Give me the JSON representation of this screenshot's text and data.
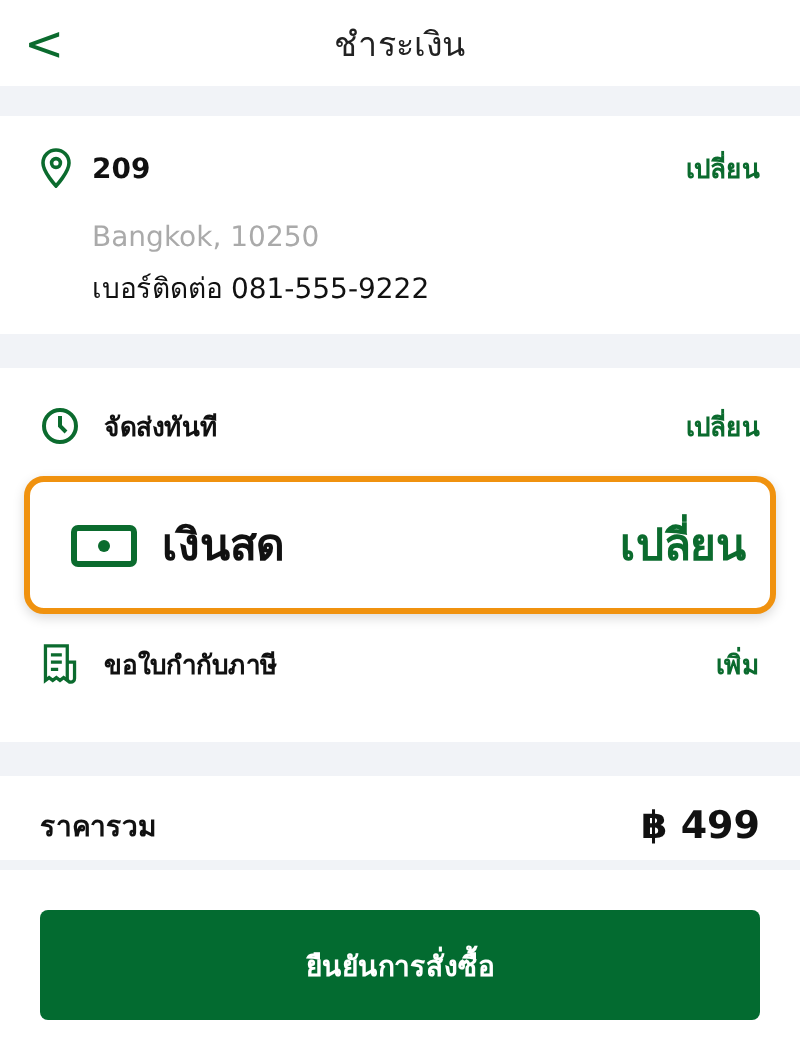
{
  "header": {
    "back": "<",
    "title": "ชำระเงิน"
  },
  "address": {
    "name": "209",
    "line": "Bangkok, 10250",
    "phone": "เบอร์ติดต่อ 081-555-9222",
    "action": "เปลี่ยน"
  },
  "options": [
    {
      "kind": "delivery",
      "label": "จัดส่งทันที",
      "action": "เปลี่ยน",
      "highlighted": false
    },
    {
      "kind": "cash",
      "label": "เงินสด",
      "action": "เปลี่ยน",
      "highlighted": true
    },
    {
      "kind": "receipt",
      "label": "ขอใบกำกับภาษี",
      "action": "เพิ่ม",
      "highlighted": false
    }
  ],
  "total": {
    "label": "ราคารวม",
    "amount": "฿ 499"
  },
  "confirm_button": "ยืนยันการสั่งซื้อ"
}
